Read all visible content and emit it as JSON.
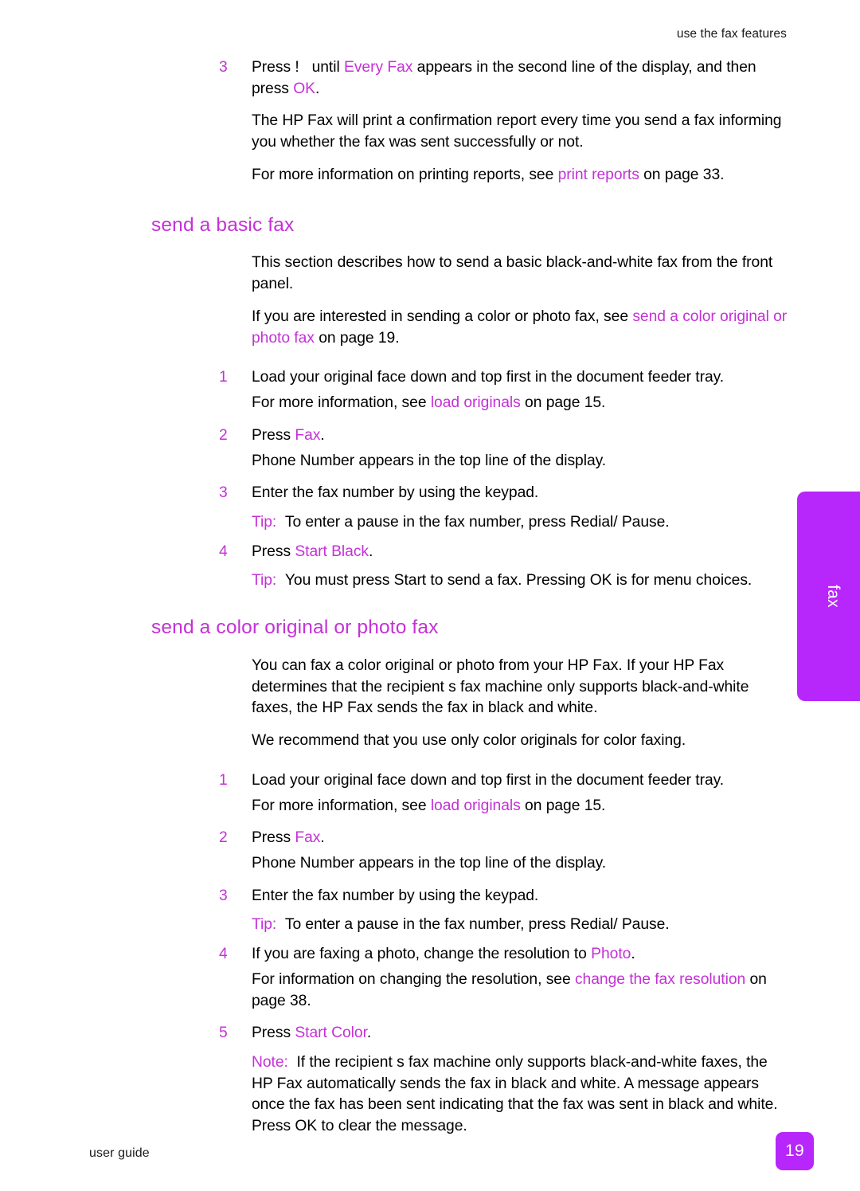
{
  "page": {
    "running_header": "use the fax features",
    "footer_left": "user guide",
    "page_number": "19",
    "thumb_tab_label": "fax",
    "accent_magenta": "#c431d6",
    "accent_purple": "#b726fb"
  },
  "top_step": {
    "number": "3",
    "text_1": "Press !",
    "text_2": "until",
    "link_1": "Every Fax",
    "text_3": "appears in the second line of the display, and then press",
    "link_2": "OK",
    "text_4": "."
  },
  "top_paragraphs": [
    "The HP Fax will print a confirmation report every time you send a fax informing you whether the fax was sent successfully or not.",
    ""
  ],
  "top_reference": {
    "before": "For more information on printing reports, see ",
    "link": "print reports",
    "after": " on page 33."
  },
  "section_basic": {
    "heading": "send a basic fax",
    "intro": "This section describes how to send a basic black-and-white fax from the front panel.",
    "cross_ref": {
      "before": "If you are interested in sending a color or photo fax, see ",
      "link": "send a color original or photo fax",
      "after": " on page 19."
    },
    "steps": [
      {
        "number": "1",
        "text": "Load your original face down and top first in the document feeder tray.",
        "cont_before": "For more information, see ",
        "cont_link": "load originals",
        "cont_after": " on page 15."
      },
      {
        "number": "2",
        "text_before": "Press ",
        "link": "Fax",
        "text_after": ".",
        "cont": "Phone Number appears in the top line of the display."
      },
      {
        "number": "3",
        "text": "Enter the fax number by using the keypad.",
        "tip_lead": "Tip:",
        "tip_text": "To enter a pause in the fax number, press Redial/ Pause."
      },
      {
        "number": "4",
        "text_before": "Press ",
        "link": "Start Black",
        "text_after": ".",
        "tip_lead": "Tip:",
        "tip_text": "You must press Start to send a fax. Pressing OK is for menu choices."
      }
    ]
  },
  "section_color": {
    "heading": "send a color original or photo fax",
    "intro_1": "You can fax a color original or photo from your HP Fax. If your HP Fax determines that the recipient s fax machine only supports black-and-white faxes, the HP Fax sends the fax in black and white.",
    "intro_2": "We recommend that you use only color originals for color faxing.",
    "steps": [
      {
        "number": "1",
        "text": "Load your original face down and top first in the document feeder tray.",
        "cont_before": "For more information, see ",
        "cont_link": "load originals",
        "cont_after": " on page 15."
      },
      {
        "number": "2",
        "text_before": "Press ",
        "link": "Fax",
        "text_after": ".",
        "cont": "Phone Number appears in the top line of the display."
      },
      {
        "number": "3",
        "text": "Enter the fax number by using the keypad.",
        "tip_lead": "Tip:",
        "tip_text": "To enter a pause in the fax number, press Redial/ Pause."
      },
      {
        "number": "4",
        "text_before": "If you are faxing a photo, change the resolution to ",
        "link": "Photo",
        "text_after": ".",
        "cont_before": "For information on changing the resolution, see ",
        "cont_link": "change the fax resolution",
        "cont_after": " on page 38."
      },
      {
        "number": "5",
        "text_before": "Press ",
        "link": "Start Color",
        "text_after": ".",
        "note_lead": "Note:",
        "note_text": "If the recipient s fax machine only supports black-and-white faxes, the HP Fax automatically sends the fax in black and white. A message appears once the fax has been sent indicating that the fax was sent in black and white. Press OK to clear the message."
      }
    ]
  }
}
